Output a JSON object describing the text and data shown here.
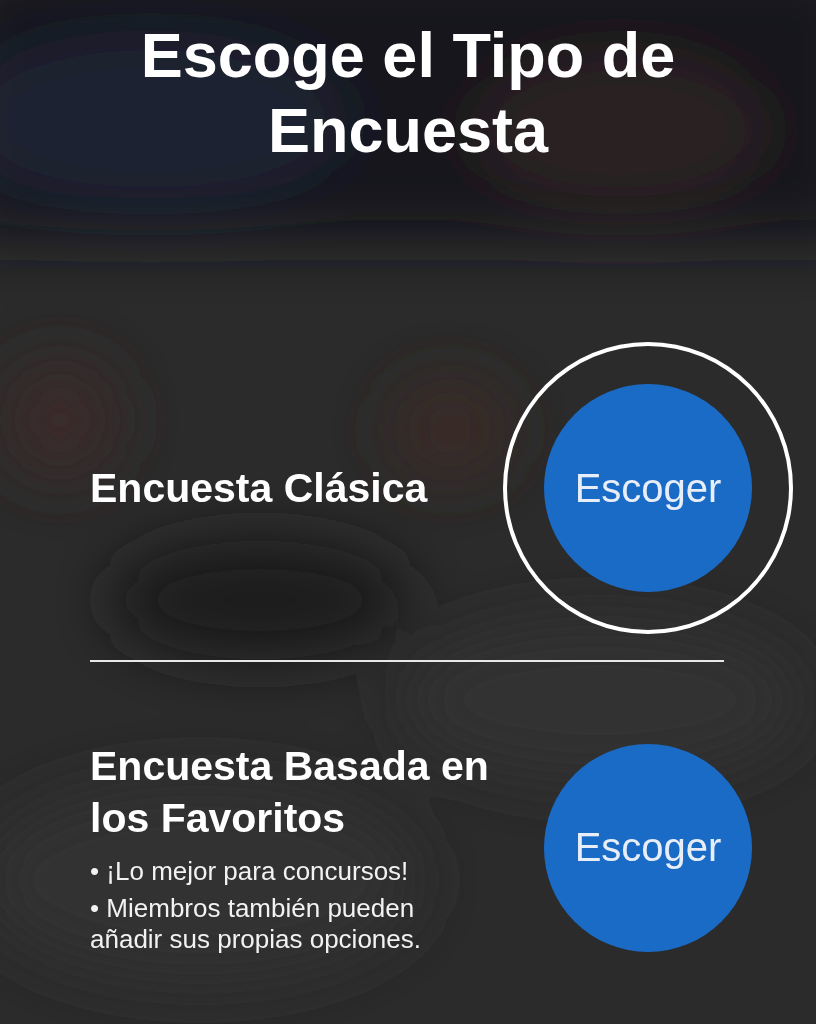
{
  "title": "Escoge el Tipo de Encuesta",
  "options": [
    {
      "title": "Encuesta Clásica",
      "button": "Escoger",
      "highlighted": true
    },
    {
      "title": "Encuesta Basada en los Favoritos",
      "bullets": [
        "• ¡Lo mejor para concursos!",
        "• Miembros también pueden añadir sus propias opciones."
      ],
      "button": "Escoger",
      "highlighted": false
    }
  ]
}
